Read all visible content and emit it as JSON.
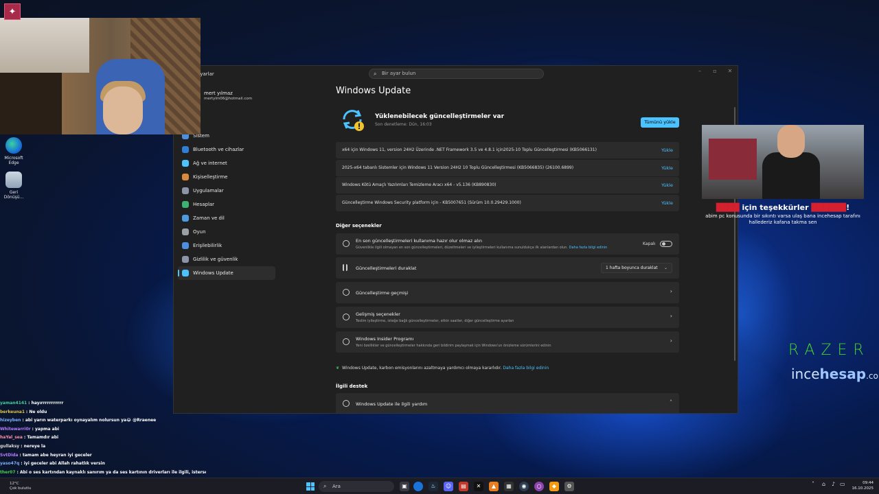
{
  "stream": {
    "logo_icon": "tiktok-like-logo",
    "thanks_prefix": "için teşekkürler",
    "thanks_highlight": "!",
    "donate_message_line1": "abim pc konusunda bir sıkıntı varsa ulaş bana incehesap tarafını",
    "donate_message_line2": "hallederiz kafana takma sen",
    "razer_text": "RAZER",
    "sponsor_part1": "ince",
    "sponsor_part2": "hesap",
    "sponsor_part3": ".com"
  },
  "desktop": {
    "icons": [
      {
        "label": "Microsoft Edge",
        "icon": "edge-icon"
      },
      {
        "label": "Geri Dönüşü...",
        "icon": "recycle-bin-icon"
      }
    ]
  },
  "settings": {
    "search_placeholder": "Bir ayar bulun",
    "app_title": "Ayarlar",
    "profile": {
      "name": "mert yılmaz",
      "email": "mertylm06@hotmail.com"
    },
    "nav": [
      {
        "label": "Sistem",
        "icon": "system-icon",
        "color": "#4c8fe0"
      },
      {
        "label": "Bluetooth ve cihazlar",
        "icon": "bluetooth-icon",
        "color": "#2f7fd6"
      },
      {
        "label": "Ağ ve internet",
        "icon": "wifi-icon",
        "color": "#4cc2ff"
      },
      {
        "label": "Kişiselleştirme",
        "icon": "brush-icon",
        "color": "#d98a3a"
      },
      {
        "label": "Uygulamalar",
        "icon": "apps-icon",
        "color": "#8b95a8"
      },
      {
        "label": "Hesaplar",
        "icon": "account-icon",
        "color": "#3cb371"
      },
      {
        "label": "Zaman ve dil",
        "icon": "globe-clock-icon",
        "color": "#4c9ae0"
      },
      {
        "label": "Oyun",
        "icon": "gamepad-icon",
        "color": "#9aa0a6"
      },
      {
        "label": "Erişilebilirlik",
        "icon": "accessibility-icon",
        "color": "#4c8fe0"
      },
      {
        "label": "Gizlilik ve güvenlik",
        "icon": "shield-icon",
        "color": "#8b95a8"
      },
      {
        "label": "Windows Update",
        "icon": "windows-update-icon",
        "color": "#4cc2ff"
      }
    ],
    "active_nav_index": 10,
    "page_title": "Windows Update",
    "status_title": "Yüklenebilecek güncelleştirmeler var",
    "status_sub": "Son denetleme: Dün, 16:03",
    "install_all": "Tümünü yükle",
    "download_label": "Yükle",
    "updates": [
      "x64 için Windows 11, version 24H2 Üzerinde .NET Framework 3.5 ve 4.8.1 için2025-10 Toplu Güncelleştirmesi (KB5066131)",
      "2025-x64 tabanlı Sistemler için Windows 11 Version 24H2 10 Toplu Güncelleştirmesi (KB5066835) (26100.6899)",
      "Windows Kötü Amaçlı Yazılımları Temizleme Aracı x64 - v5.136 (KB890830)",
      "Güncelleştirme Windows Security platform için - KB5007651 (Sürüm 10.0.29429.1000)"
    ],
    "other_options_label": "Diğer seçenekler",
    "options": {
      "latest": {
        "title": "En son güncelleştirmeleri kullanıma hazır olur olmaz alın",
        "desc": "Güvenlikle ilgili olmayan en son güncelleştirmeleri, düzeltmeleri ve iyileştirmeleri kullanıma sunuldukça ilk alanlardan olun.",
        "link": "Daha fazla bilgi edinin",
        "toggle_label": "Kapalı"
      },
      "pause": {
        "title": "Güncelleştirmeleri duraklat",
        "value": "1 hafta boyunca duraklat"
      },
      "history": {
        "title": "Güncelleştirme geçmişi"
      },
      "advanced": {
        "title": "Gelişmiş seçenekler",
        "desc": "Teslim iyileştirme, isteğe bağlı güncelleştirmeler, etkin saatler, diğer güncelleştirme ayarları"
      },
      "insider": {
        "title": "Windows Insider Programı",
        "desc": "Yeni özellikler ve güncelleştirmeler hakkında geri bildirim paylaşmak için Windows'un önizleme sürümlerini edinin"
      }
    },
    "eco_text": "Windows Update, karbon emisyonlarını azaltmaya yardımcı olmaya kararlıdır.",
    "eco_link": "Daha fazla bilgi edinin",
    "support_label": "İlgili destek",
    "support_item": "Windows Update ile ilgili yardım"
  },
  "chat": [
    {
      "user": "yaman4141",
      "msg": ": hayırrrrrrrrrrr",
      "color": "#3fd0a0"
    },
    {
      "user": "berkeuna1",
      "msg": ": Ne oldu",
      "color": "#e0c24a"
    },
    {
      "user": "hizeyben",
      "msg": ": abi yarın waterparkı oynayalım nolursun ya😂 @Rraenee",
      "color": "#7fb0ff"
    },
    {
      "user": "Whitewarri0r",
      "msg": ": yapma abi",
      "color": "#b57cff"
    },
    {
      "user": "haYal_sea",
      "msg": ": Tamamdır abi",
      "color": "#ff8fb0"
    },
    {
      "user": "gullaksy",
      "msg": ": nereye la",
      "color": "#dddddd"
    },
    {
      "user": "SvtDida",
      "msg": ": tamam abe heyran iyi geceler",
      "color": "#b57cff"
    },
    {
      "user": "yaso47q",
      "msg": ": iyi geceler abi Allah rahatlık versin",
      "color": "#7fb0ff"
    },
    {
      "user": "ther07",
      "msg": ": Abi o ses kartından kaynaklı sanırım ya da ses kartının driverları ile ilgili, istersen",
      "color": "#4ad04a"
    },
    {
      "user": "",
      "msg": "elip bakabilirim tamamen ücretsiz istersen yeni parça lazım olursa da alırım@RRaenee",
      "color": "#ffffff"
    }
  ],
  "taskbar": {
    "weather_temp": "12°C",
    "weather_desc": "Çok bulutlu",
    "search_label": "Ara",
    "time": "09:44",
    "date": "16.10.2025"
  }
}
